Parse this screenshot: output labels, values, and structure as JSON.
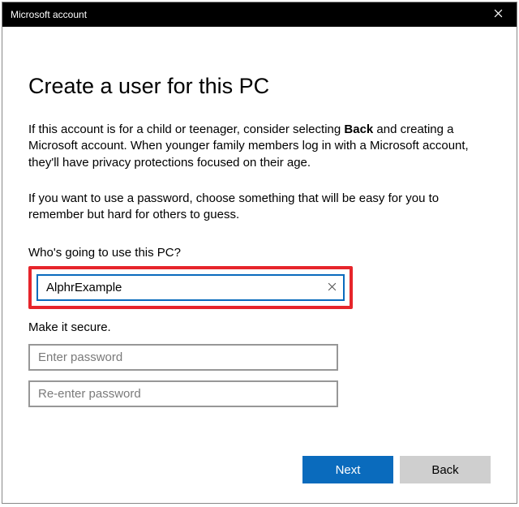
{
  "titlebar": {
    "title": "Microsoft account"
  },
  "page": {
    "heading": "Create a user for this PC",
    "para1_pre": "If this account is for a child or teenager, consider selecting ",
    "para1_bold": "Back",
    "para1_post": " and creating a Microsoft account. When younger family members log in with a Microsoft account, they'll have privacy protections focused on their age.",
    "para2": "If you want to use a password, choose something that will be easy for you to remember but hard for others to guess."
  },
  "form": {
    "who_label": "Who's going to use this PC?",
    "username_value": "AlphrExample",
    "secure_label": "Make it secure.",
    "password_placeholder": "Enter password",
    "repassword_placeholder": "Re-enter password"
  },
  "buttons": {
    "next": "Next",
    "back": "Back"
  }
}
